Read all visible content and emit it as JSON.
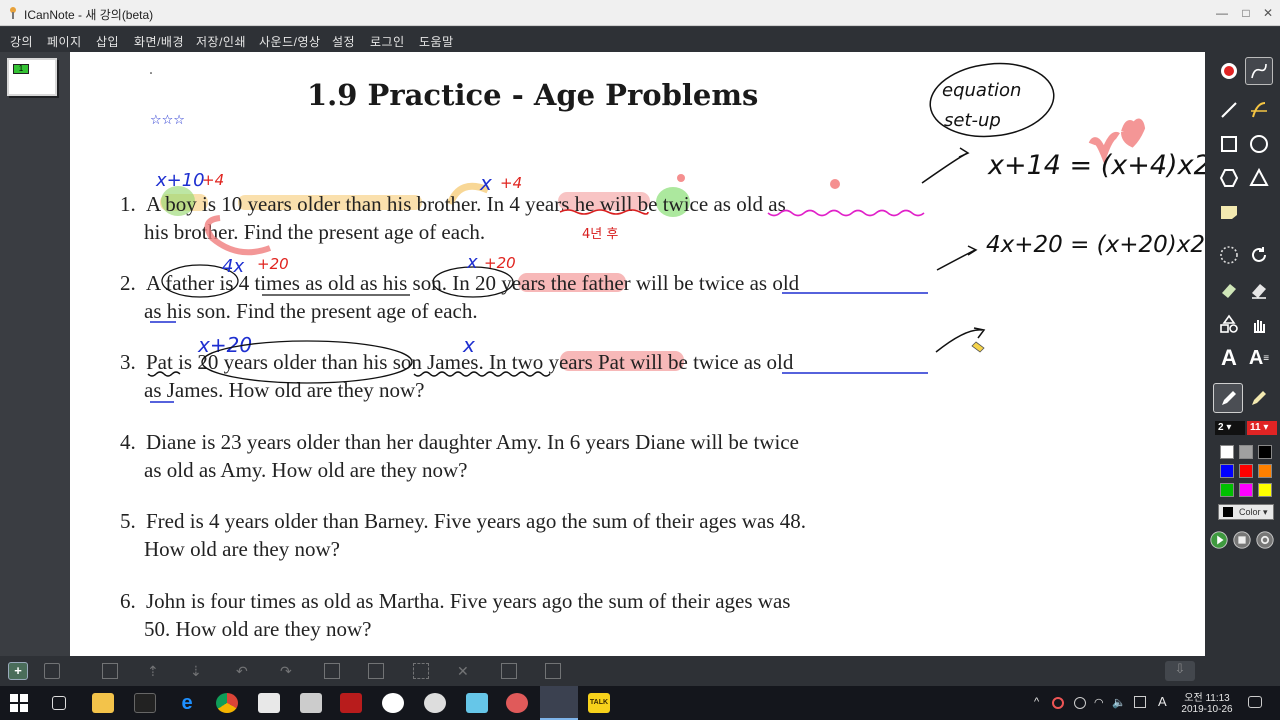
{
  "window": {
    "title": "ICanNote - 새 강의(beta)",
    "controls": [
      "minimize",
      "maximize",
      "close"
    ]
  },
  "menu": [
    "강의",
    "페이지",
    "삽입",
    "화면/배경",
    "저장/인쇄",
    "사운드/영상",
    "설정",
    "로그인",
    "도움말"
  ],
  "thumbnail": {
    "page_number": "1"
  },
  "page": {
    "title": "1.9 Practice - Age Problems",
    "problems": [
      {
        "n": "1.",
        "line1": "A boy is 10 years older than his brother. In 4 years he will be twice as old as",
        "line2": "his brother. Find the present age of each."
      },
      {
        "n": "2.",
        "line1": "A father is 4 times as old as his son. In 20 years the father will be twice as old",
        "line2": "as his son. Find the present age of each."
      },
      {
        "n": "3.",
        "line1": "Pat is 20 years older than his son James. In two years Pat will be twice as old",
        "line2": "as James. How old are they now?"
      },
      {
        "n": "4.",
        "line1": "Diane is 23 years older than her daughter Amy. In 6 years Diane will be twice",
        "line2": "as old as Amy. How old are they now?"
      },
      {
        "n": "5.",
        "line1": "Fred is 4 years older than Barney. Five years ago the sum of their ages was 48.",
        "line2": "How old are they now?"
      },
      {
        "n": "6.",
        "line1": "John is four times as old as Martha. Five years ago the sum of their ages was",
        "line2": "50. How old are they now?"
      }
    ],
    "handwriting": {
      "stars": "☆☆☆",
      "p1_boy": "x+10",
      "p1_boy_add": "+4",
      "p1_brother": "x",
      "p1_brother_add": "+4",
      "p1_korean": "4년 후",
      "p2_father": "4x",
      "p2_father_add": "+20",
      "p2_son": "x",
      "p2_son_add": "+20",
      "p3_pat": "x+20",
      "p3_james": "x",
      "bubble": [
        "equation",
        "set-up"
      ],
      "eq1": "x+14 = (x+4)x2",
      "eq2": "4x+20 = (x+20)x2"
    }
  },
  "tools": {
    "thickness": "2",
    "font_size": "11",
    "color_button": "Color",
    "palette": [
      "#ffffff",
      "#a0a0a0",
      "#000000",
      "#0000ff",
      "#ff0000",
      "#ff8000",
      "#00c000",
      "#ff00ff",
      "#ffff00"
    ]
  },
  "taskbar": {
    "clock_ampm": "오전",
    "clock_time": "11:13",
    "clock_date": "2019-10-26",
    "lang": "A"
  }
}
